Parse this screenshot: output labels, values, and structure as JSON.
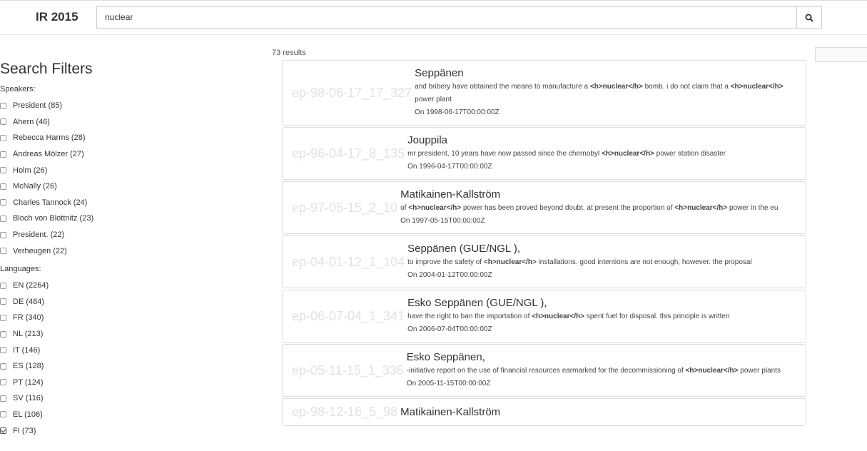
{
  "header": {
    "brand": "IR 2015",
    "search_value": "nuclear",
    "search_icon": "search-icon"
  },
  "sidebar": {
    "title": "Search Filters",
    "speakers_label": "Speakers:",
    "speakers": [
      {
        "label": "President (85)",
        "checked": false
      },
      {
        "label": "Ahern (46)",
        "checked": false
      },
      {
        "label": "Rebecca Harms (28)",
        "checked": false
      },
      {
        "label": "Andreas Mölzer (27)",
        "checked": false
      },
      {
        "label": "Holm (26)",
        "checked": false
      },
      {
        "label": "McNally (26)",
        "checked": false
      },
      {
        "label": "Charles Tannock (24)",
        "checked": false
      },
      {
        "label": "Bloch von Blottnitz (23)",
        "checked": false
      },
      {
        "label": "President. (22)",
        "checked": false
      },
      {
        "label": "Verheugen (22)",
        "checked": false
      }
    ],
    "languages_label": "Languages:",
    "languages": [
      {
        "label": "EN (2264)",
        "checked": false
      },
      {
        "label": "DE (484)",
        "checked": false
      },
      {
        "label": "FR (340)",
        "checked": false
      },
      {
        "label": "NL (213)",
        "checked": false
      },
      {
        "label": "IT (146)",
        "checked": false
      },
      {
        "label": "ES (128)",
        "checked": false
      },
      {
        "label": "PT (124)",
        "checked": false
      },
      {
        "label": "SV (116)",
        "checked": false
      },
      {
        "label": "EL (106)",
        "checked": false
      },
      {
        "label": "FI (73)",
        "checked": true
      }
    ]
  },
  "results": {
    "count_text": "73 results",
    "items": [
      {
        "id": "ep-98-06-17_17_327",
        "speaker": "Seppänen",
        "snippet": "and bribery have obtained the means to manufacture a <h>nuclear</h> bomb. i do not claim that a <h>nuclear</h> power plant",
        "date": "On 1998-06-17T00:00:00Z"
      },
      {
        "id": "ep-96-04-17_8_135",
        "speaker": "Jouppila",
        "snippet": "mr president, 10 years have now passed since the chernobyl <h>nuclear</h> power station disaster",
        "date": "On 1996-04-17T00:00:00Z"
      },
      {
        "id": "ep-97-05-15_2_10",
        "speaker": "Matikainen-Kallström",
        "snippet": "of <h>nuclear</h> power has been proved beyond doubt. at present the proportion of <h>nuclear</h> power in the eu",
        "date": "On 1997-05-15T00:00:00Z"
      },
      {
        "id": "ep-04-01-12_1_104",
        "speaker": "Seppänen (GUE/NGL ),",
        "snippet": "to improve the safety of <h>nuclear</h> installations. good intentions are not enough, however. the proposal",
        "date": "On 2004-01-12T00:00:00Z"
      },
      {
        "id": "ep-06-07-04_1_341",
        "speaker": "Esko Seppänen (GUE/NGL ),",
        "snippet": "have the right to ban the importation of <h>nuclear</h> spent fuel for disposal. this principle is written",
        "date": "On 2006-07-04T00:00:00Z"
      },
      {
        "id": "ep-05-11-15_1_336",
        "speaker": "Esko Seppänen,",
        "snippet": "-initiative report on the use of financial resources earmarked for the decommissioning of <h>nuclear</h> power plants",
        "date": "On 2005-11-15T00:00:00Z"
      },
      {
        "id": "ep-98-12-16_5_98",
        "speaker": "Matikainen-Kallström",
        "snippet": "",
        "date": ""
      }
    ]
  }
}
